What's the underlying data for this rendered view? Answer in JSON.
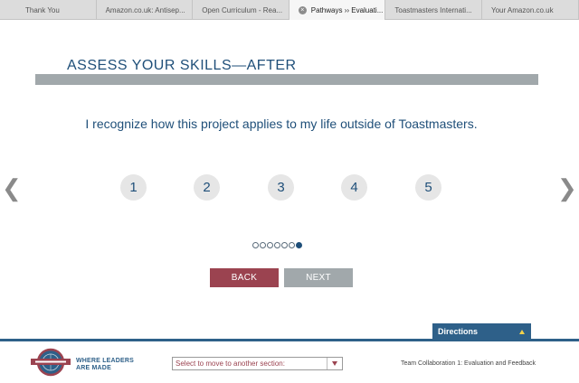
{
  "browser": {
    "tabs": [
      {
        "label": "Thank You",
        "active": false
      },
      {
        "label": "Amazon.co.uk: Antisep...",
        "active": false
      },
      {
        "label": "Open Curriculum - Rea...",
        "active": false
      },
      {
        "label": "Pathways ›› Evaluati...",
        "active": true
      },
      {
        "label": "Toastmasters Internati...",
        "active": false
      },
      {
        "label": "Your Amazon.co.uk",
        "active": false
      }
    ],
    "close_glyph": "×"
  },
  "page": {
    "title": "ASSESS YOUR SKILLS—AFTER",
    "question": "I recognize how this project applies to my life outside of Toastmasters.",
    "prev_arrow": "❮",
    "next_arrow": "❯",
    "ratings": [
      "1",
      "2",
      "3",
      "4",
      "5"
    ],
    "progress": {
      "total": 7,
      "current": 7
    },
    "back_label": "BACK",
    "next_label": "NEXT"
  },
  "directions": {
    "label": "Directions"
  },
  "footer": {
    "tagline_line1": "WHERE LEADERS",
    "tagline_line2": "ARE MADE",
    "select_text": "Select to move to another section:",
    "project_label": "Team Collaboration 1: Evaluation and Feedback"
  },
  "colors": {
    "accent_blue": "#1f4f79",
    "back_button": "#9b4350",
    "next_button": "#a1a8ab",
    "directions_bar": "#2e6089"
  }
}
